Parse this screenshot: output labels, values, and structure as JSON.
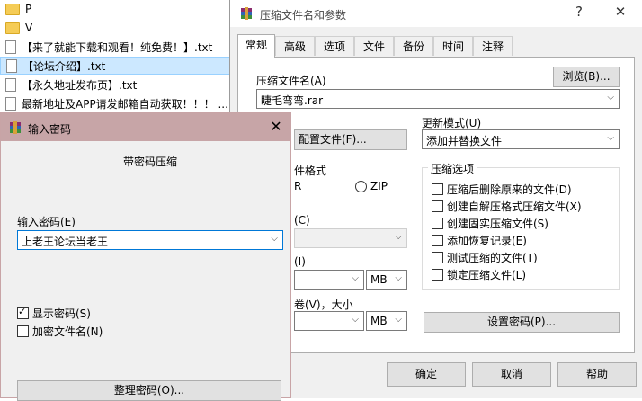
{
  "file_list": [
    {
      "type": "folder",
      "name": "P",
      "selected": false
    },
    {
      "type": "folder",
      "name": "V",
      "selected": false
    },
    {
      "type": "file",
      "name": "【来了就能下载和观看！纯免费！】.txt",
      "selected": false
    },
    {
      "type": "file",
      "name": "【论坛介绍】.txt",
      "selected": true
    },
    {
      "type": "file",
      "name": "【永久地址发布页】.txt",
      "selected": false
    },
    {
      "type": "file",
      "name": "最新地址及APP请发邮箱自动获取！！！ ...",
      "selected": false
    }
  ],
  "archive_dialog": {
    "title": "压缩文件名和参数",
    "help_btn": "?",
    "close_btn": "✕",
    "tabs": [
      "常规",
      "高级",
      "选项",
      "文件",
      "备份",
      "时间",
      "注释"
    ],
    "archive_name_label": "压缩文件名(A)",
    "browse_button": "浏览(B)...",
    "archive_name_value": "睫毛弯弯.rar",
    "profile_button": "配置文件(F)...",
    "update_mode_label": "更新模式(U)",
    "update_mode_value": "添加并替换文件",
    "format_label": "件格式",
    "format_rar": "R",
    "format_zip": "ZIP",
    "method_label": "(C)",
    "dict_label": "(I)",
    "dict_unit": "MB",
    "split_label": "卷(V)，大小",
    "split_unit": "MB",
    "options_group_title": "压缩选项",
    "options": [
      {
        "label": "压缩后删除原来的文件(D)",
        "checked": false
      },
      {
        "label": "创建自解压格式压缩文件(X)",
        "checked": false
      },
      {
        "label": "创建固实压缩文件(S)",
        "checked": false
      },
      {
        "label": "添加恢复记录(E)",
        "checked": false
      },
      {
        "label": "测试压缩的文件(T)",
        "checked": false
      },
      {
        "label": "锁定压缩文件(L)",
        "checked": false
      }
    ],
    "set_password_button": "设置密码(P)...",
    "ok_button": "确定",
    "cancel_button": "取消",
    "help_button": "帮助"
  },
  "password_dialog": {
    "title": "输入密码",
    "close_btn": "✕",
    "heading": "带密码压缩",
    "password_label": "输入密码(E)",
    "password_value": "上老王论坛当老王",
    "show_password_label": "显示密码(S)",
    "show_password_checked": true,
    "encrypt_names_label": "加密文件名(N)",
    "encrypt_names_checked": false,
    "organize_button": "整理密码(O)..."
  },
  "colors": {
    "selection_bg": "#cce8ff",
    "password_titlebar": "#c7a5a7",
    "dialog_bg": "#f0f0f0"
  }
}
